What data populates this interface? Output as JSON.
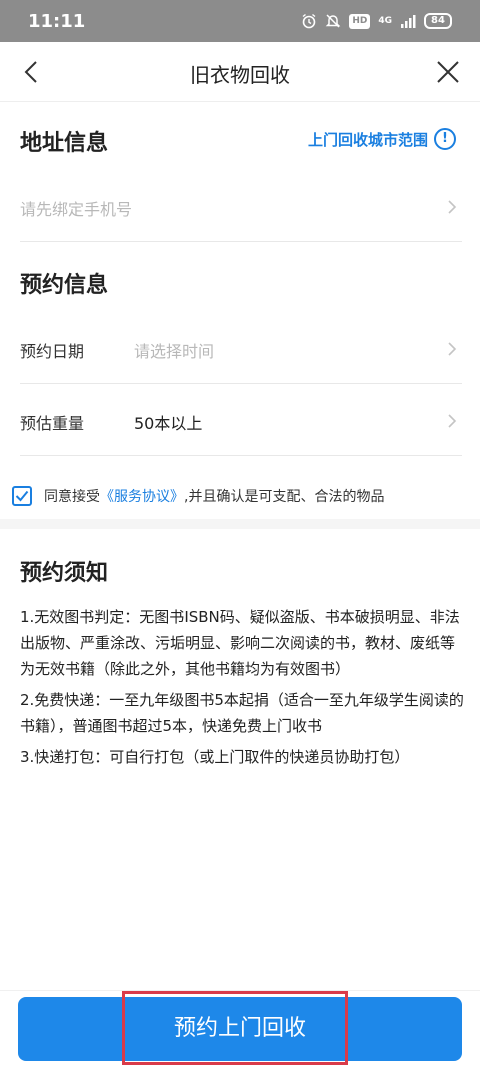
{
  "status_bar": {
    "time": "11:11",
    "hd": "HD",
    "network": "4G",
    "battery": "84"
  },
  "nav": {
    "title": "旧衣物回收",
    "back_icon": "chevron-left-icon",
    "close_icon": "close-icon"
  },
  "address": {
    "title": "地址信息",
    "range_link": "上门回收城市范围",
    "phone_placeholder": "请先绑定手机号"
  },
  "booking": {
    "title": "预约信息",
    "date_label": "预约日期",
    "date_placeholder": "请选择时间",
    "weight_label": "预估重量",
    "weight_value": "50本以上"
  },
  "agreement": {
    "prefix": "同意接受",
    "link": "《服务协议》",
    "suffix": ",并且确认是可支配、合法的物品",
    "checked": true
  },
  "notice": {
    "title": "预约须知",
    "items": [
      "1.无效图书判定：无图书ISBN码、疑似盗版、书本破损明显、非法出版物、严重涂改、污垢明显、影响二次阅读的书，教材、废纸等为无效书籍（除此之外，其他书籍均为有效图书）",
      "2.免费快递：一至九年级图书5本起捐（适合一至九年级学生阅读的书籍），普通图书超过5本，快递免费上门收书",
      "3.快递打包：可自行打包（或上门取件的快递员协助打包）"
    ]
  },
  "submit": {
    "label": "预约上门回收"
  },
  "colors": {
    "accent": "#1e88e9",
    "link": "#1a7fe0",
    "highlight": "#d93b4a"
  }
}
